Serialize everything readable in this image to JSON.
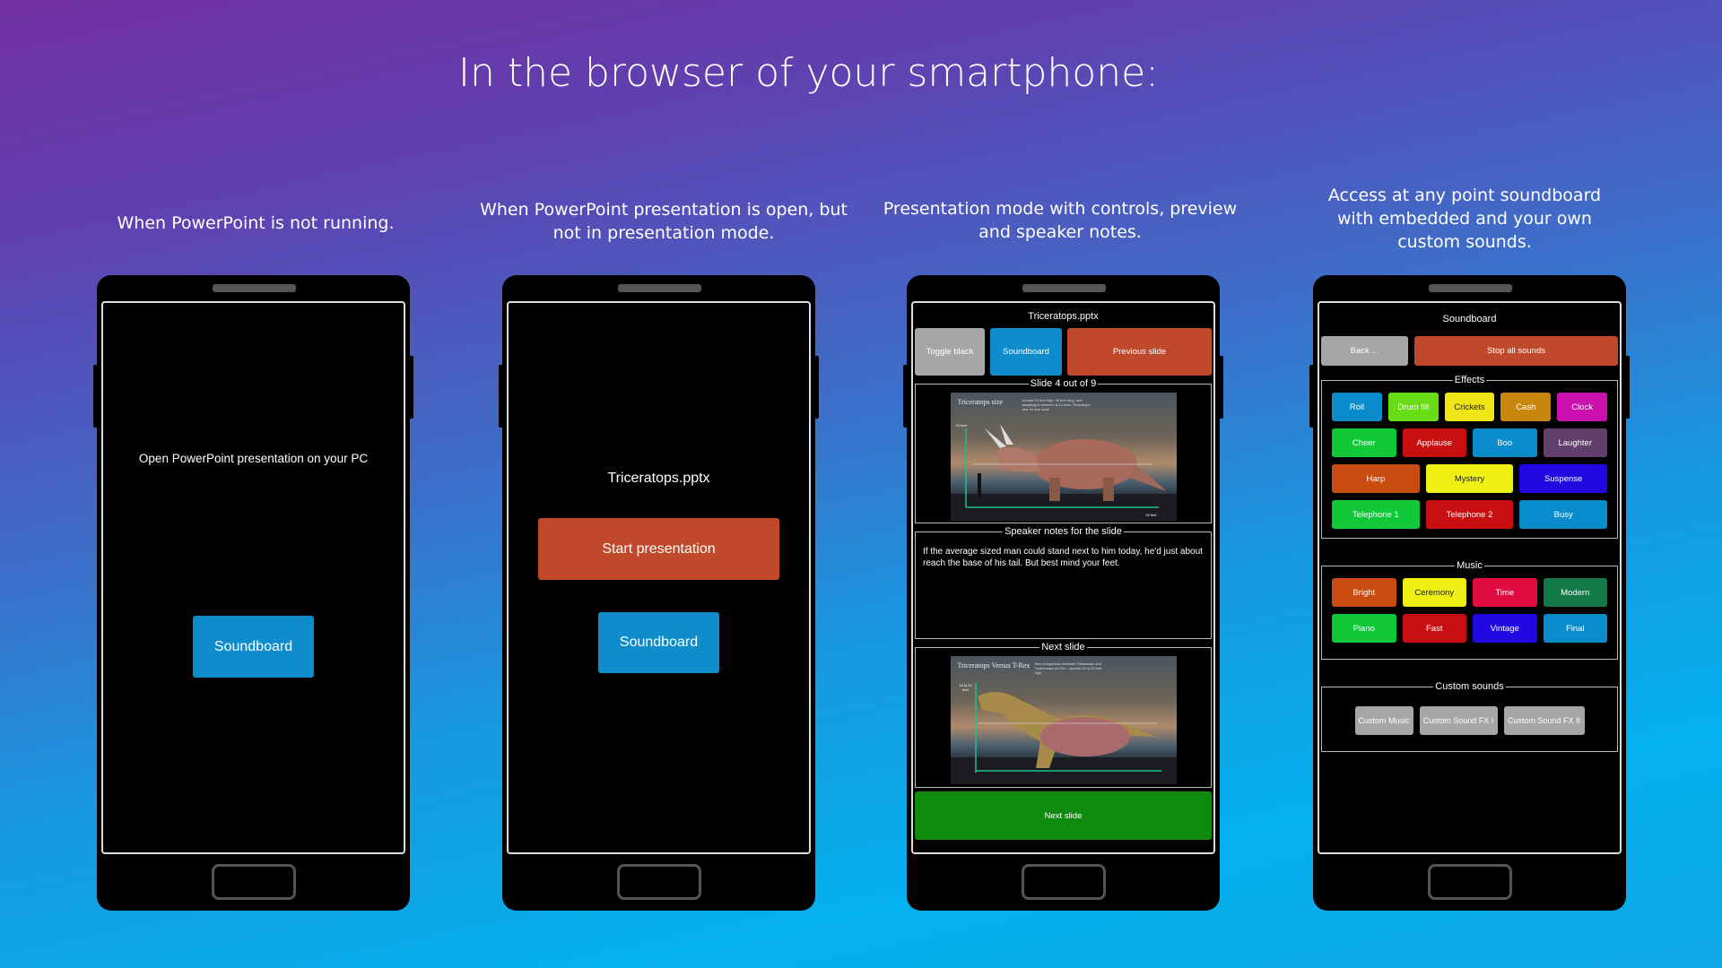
{
  "title": "In the browser of your smartphone:",
  "captions": [
    "When PowerPoint is not running.",
    "When PowerPoint presentation is open, but not in presentation mode.",
    "Presentation mode with controls, preview and speaker notes.",
    "Access at any point soundboard with embedded and your own custom sounds."
  ],
  "phone1": {
    "message": "Open PowerPoint presentation on your PC",
    "soundboard": "Soundboard"
  },
  "phone2": {
    "filename": "Triceratops.pptx",
    "start": "Start presentation",
    "soundboard": "Soundboard"
  },
  "phone3": {
    "filename": "Triceratops.pptx",
    "toggle_black": "Toggle black",
    "soundboard": "Soundboard",
    "previous": "Previous slide",
    "slide_legend": "Slide 4 out of 9",
    "current_slide": {
      "title": "Triceratops size",
      "text": "Around 10 feet high, 26 feet long, and weighing in between 6-12 tons; Triceratops was no size zero!",
      "label_height": "10 feet",
      "label_length": "26 feet"
    },
    "notes_legend": "Speaker notes for the slide",
    "notes": "If the average sized man could stand next to him today, he'd just about reach the base of his tail. But best mind your feet.",
    "next_legend": "Next slide",
    "next_slide": {
      "title": "Triceratops Versus T-Rex",
      "text": "Size comparison between Triceratops and Tyrannosaurus Rex – around 15 to 20 feet high",
      "label_height": "15 to 20 feet"
    },
    "next_button": "Next slide"
  },
  "phone4": {
    "title": "Soundboard",
    "back": "Back ...",
    "stop": "Stop all sounds",
    "effects_legend": "Effects",
    "effects": [
      [
        {
          "label": "Roll",
          "color": "#0a8ccc"
        },
        {
          "label": "Drum fill",
          "color": "#66dd14"
        },
        {
          "label": "Crickets",
          "color": "#efe414",
          "dark": true
        },
        {
          "label": "Cash",
          "color": "#c8860c"
        },
        {
          "label": "Clock",
          "color": "#cc10b0"
        }
      ],
      [
        {
          "label": "Cheer",
          "color": "#10c838"
        },
        {
          "label": "Applause",
          "color": "#c81010"
        },
        {
          "label": "Boo",
          "color": "#0a8ccc"
        },
        {
          "label": "Laughter",
          "color": "#603f6a"
        }
      ],
      [
        {
          "label": "Harp",
          "color": "#c84c10"
        },
        {
          "label": "Mystery",
          "color": "#efef14",
          "dark": true
        },
        {
          "label": "Suspense",
          "color": "#2208e0"
        }
      ],
      [
        {
          "label": "Telephone 1",
          "color": "#10c838"
        },
        {
          "label": "Telephone 2",
          "color": "#c80e10"
        },
        {
          "label": "Busy",
          "color": "#0a8ccc"
        }
      ]
    ],
    "music_legend": "Music",
    "music": [
      [
        {
          "label": "Bright",
          "color": "#c84c10"
        },
        {
          "label": "Ceremony",
          "color": "#efef14",
          "dark": true
        },
        {
          "label": "Time",
          "color": "#e00c40"
        },
        {
          "label": "Modern",
          "color": "#127a48"
        }
      ],
      [
        {
          "label": "Piano",
          "color": "#10c838"
        },
        {
          "label": "Fast",
          "color": "#c80e10"
        },
        {
          "label": "Vintage",
          "color": "#2208e0"
        },
        {
          "label": "Final",
          "color": "#0a8ccc"
        }
      ]
    ],
    "custom_legend": "Custom sounds",
    "custom": [
      "Custom Music",
      "Custom Sound FX I",
      "Custom Sound FX II"
    ]
  },
  "colors": {
    "blue": "#0e8ccb",
    "orange": "#c0492b",
    "grey": "#a6a6a6",
    "green": "#0e8a0e"
  }
}
